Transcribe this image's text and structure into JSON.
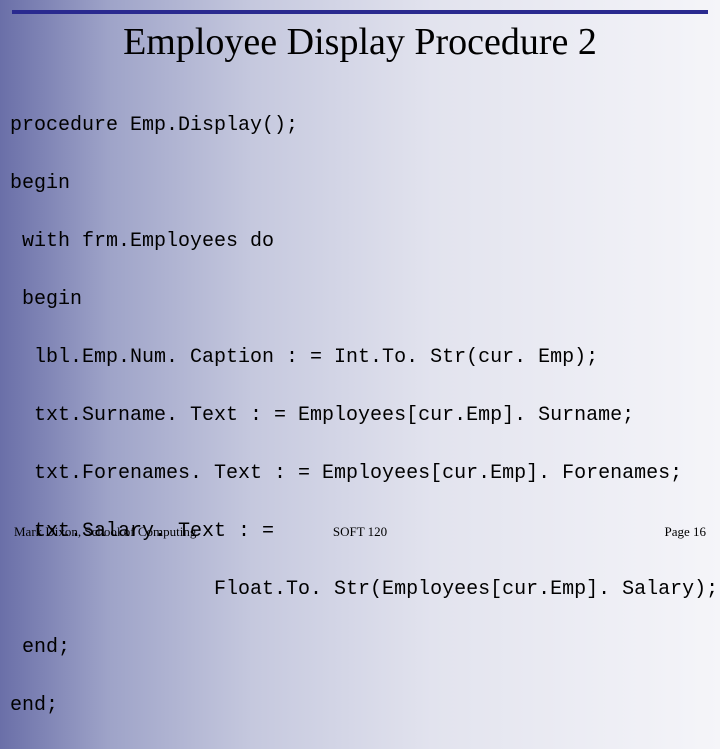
{
  "title": "Employee Display Procedure 2",
  "code": {
    "l1": "procedure Emp.Display();",
    "l2": "begin",
    "l3": " with frm.Employees do",
    "l4": " begin",
    "l5": "  lbl.Emp.Num. Caption : = Int.To. Str(cur. Emp);",
    "l6": "  txt.Surname. Text : = Employees[cur.Emp]. Surname;",
    "l7": "  txt.Forenames. Text : = Employees[cur.Emp]. Forenames;",
    "l8": "  txt.Salary. Text : =",
    "l9": "                 Float.To. Str(Employees[cur.Emp]. Salary);",
    "l10": " end;",
    "l11": "end;"
  },
  "footer": {
    "left": "Mark Dixon, School of Computing",
    "center": "SOFT 120",
    "right": "Page 16"
  }
}
